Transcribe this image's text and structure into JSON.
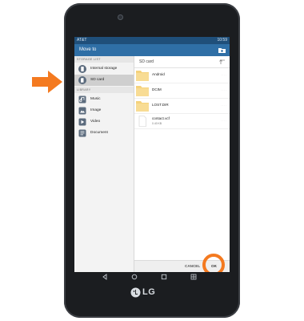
{
  "colors": {
    "status_bar": "#1f4f7a",
    "title_bar": "#2f6fa6",
    "accent_orange": "#f47a20",
    "folder_yellow": "#f5d27c"
  },
  "status_bar": {
    "left_text": "AT&T",
    "time": "10:59"
  },
  "dialog": {
    "title": "Move to",
    "new_folder_icon": "new-folder-icon"
  },
  "left_panel": {
    "storage_header": "STORAGE LIST",
    "storage_items": [
      {
        "label": "Internal storage",
        "icon": "phone-storage-icon"
      },
      {
        "label": "SD card",
        "icon": "sd-card-icon",
        "selected": true
      }
    ],
    "library_header": "LIBRARY",
    "library_items": [
      {
        "label": "Music",
        "icon": "music-icon"
      },
      {
        "label": "Image",
        "icon": "image-icon"
      },
      {
        "label": "Video",
        "icon": "video-icon"
      },
      {
        "label": "Document",
        "icon": "document-icon"
      }
    ]
  },
  "right_panel": {
    "path": "SD card",
    "up_icon": "up-arrow-icon",
    "files": [
      {
        "name": "Android",
        "type": "folder"
      },
      {
        "name": "DCIM",
        "type": "folder"
      },
      {
        "name": "LOST.DIR",
        "type": "folder"
      },
      {
        "name": "contact.vcf",
        "size": "0.40 KB",
        "type": "file"
      }
    ]
  },
  "actions": {
    "cancel": "CANCEL",
    "ok": "OK"
  },
  "device": {
    "brand": "LG"
  }
}
